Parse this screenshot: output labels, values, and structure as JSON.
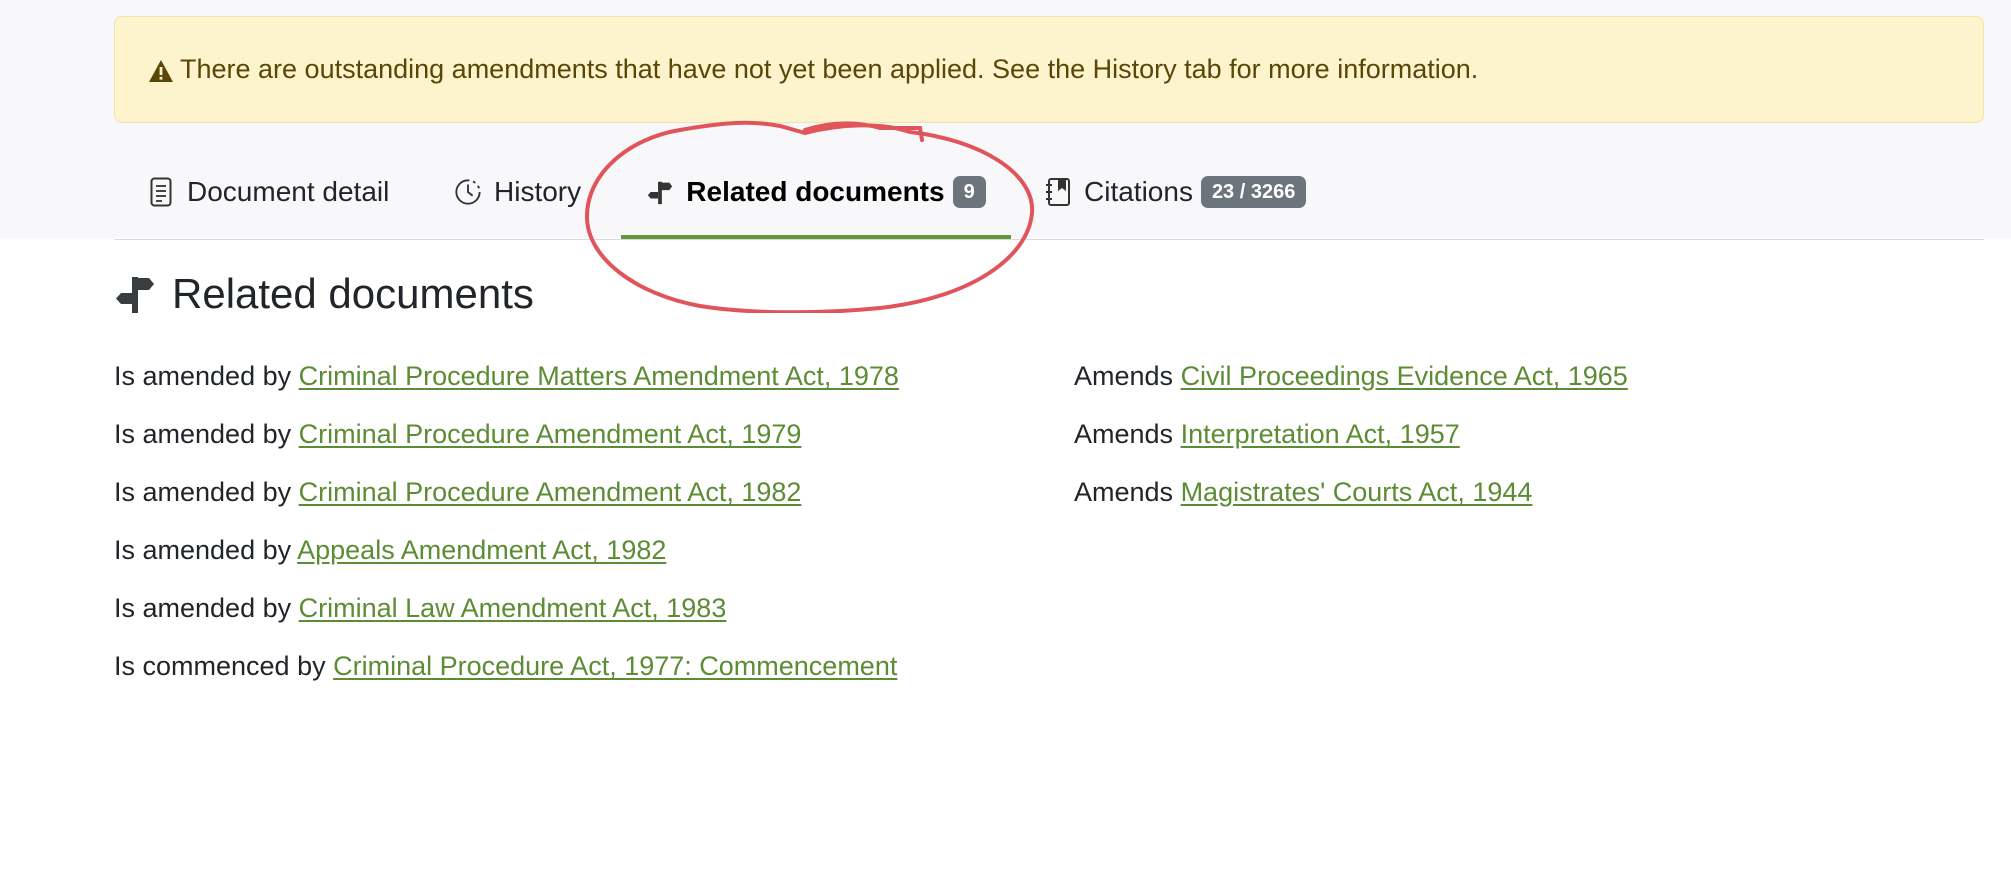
{
  "alert": {
    "text": "There are outstanding amendments that have not yet been applied. See the History tab for more information."
  },
  "tabs": [
    {
      "label": "Document detail",
      "icon": "document-icon"
    },
    {
      "label": "History",
      "icon": "clock-icon"
    },
    {
      "label": "Related documents",
      "icon": "signpost-icon",
      "badge": "9",
      "active": true
    },
    {
      "label": "Citations",
      "icon": "journal-icon",
      "badge": "23 / 3266"
    }
  ],
  "section": {
    "title": "Related documents",
    "icon": "signpost-icon"
  },
  "relations_left": [
    {
      "prefix": "Is amended by",
      "link": "Criminal Procedure Matters Amendment Act, 1978"
    },
    {
      "prefix": "Is amended by",
      "link": "Criminal Procedure Amendment Act, 1979"
    },
    {
      "prefix": "Is amended by",
      "link": "Criminal Procedure Amendment Act, 1982"
    },
    {
      "prefix": "Is amended by",
      "link": "Appeals Amendment Act, 1982"
    },
    {
      "prefix": "Is amended by",
      "link": "Criminal Law Amendment Act, 1983"
    },
    {
      "prefix": "Is commenced by",
      "link": "Criminal Procedure Act, 1977: Commencement"
    }
  ],
  "relations_right": [
    {
      "prefix": "Amends",
      "link": "Civil Proceedings Evidence Act, 1965"
    },
    {
      "prefix": "Amends",
      "link": "Interpretation Act, 1957"
    },
    {
      "prefix": "Amends",
      "link": "Magistrates' Courts Act, 1944"
    }
  ],
  "colors": {
    "link": "#5c8c34",
    "active_tab_underline": "#66963b",
    "alert_bg": "#fdf3cd",
    "badge_bg": "#6c757d",
    "annotation_circle": "#e0555c"
  }
}
